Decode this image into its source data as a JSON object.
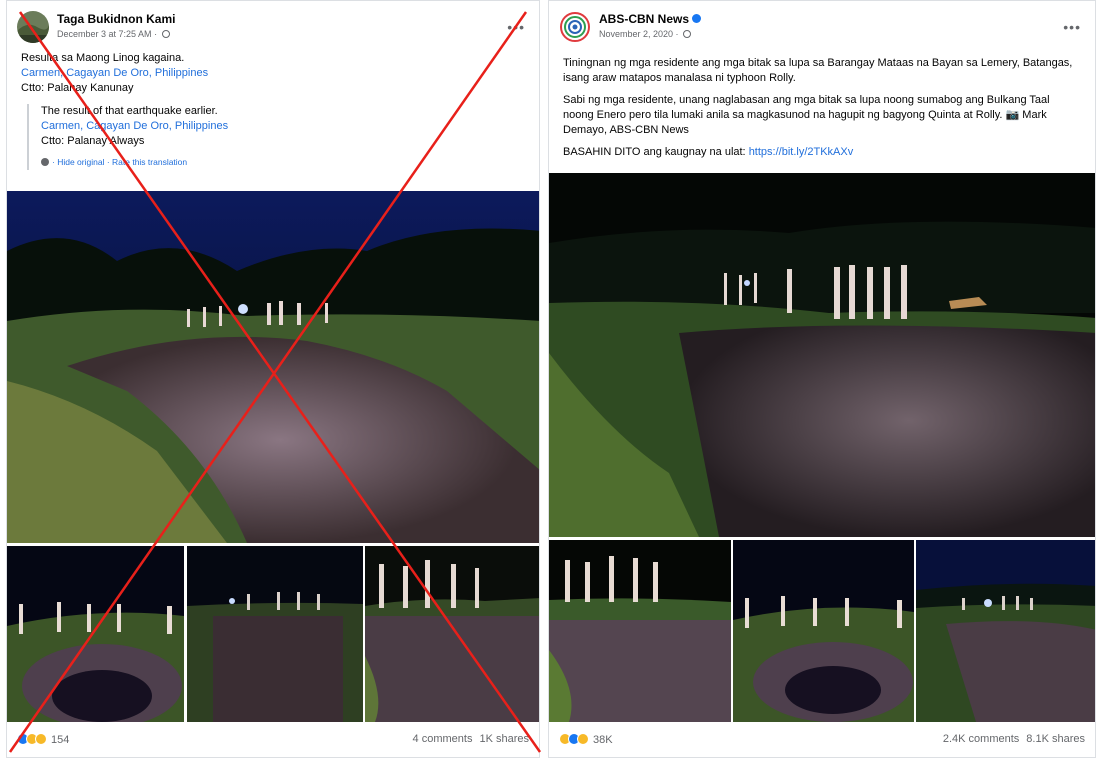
{
  "left_post": {
    "page_name": "Taga Bukidnon Kami",
    "date": "December 3 at 7:25 AM",
    "original_text": "Resulta sa Maong Linog kagaina.",
    "location": "Carmen, Cagayan De Oro, Philippines",
    "credit": "Ctto: Palanay Kanunay",
    "translation": {
      "text": "The result of that earthquake earlier.",
      "location": "Carmen, Cagayan De Oro, Philippines",
      "credit": "Ctto: Palanay Always",
      "hide_original": "Hide original",
      "rate": "Rate this translation"
    },
    "reaction_count": "154",
    "comments": "4 comments",
    "shares": "1K shares"
  },
  "right_post": {
    "page_name": "ABS-CBN News",
    "date": "November 2, 2020",
    "paragraph1": "Tiningnan ng mga residente ang mga bitak sa lupa sa Barangay Mataas na Bayan sa Lemery, Batangas, isang araw matapos manalasa ni typhoon Rolly.",
    "paragraph2": "Sabi ng mga residente, unang naglabasan ang mga bitak sa lupa noong sumabog ang Bulkang Taal noong Enero pero tila lumaki anila sa magkasunod na hagupit ng bagyong Quinta at Rolly. 📷 Mark Demayo, ABS-CBN News",
    "paragraph3_prefix": "BASAHIN DITO ang kaugnay na ulat: ",
    "link": "https://bit.ly/2TKkAXv",
    "reaction_count": "38K",
    "comments": "2.4K comments",
    "shares": "8.1K shares"
  },
  "colors": {
    "link": "#216fdb",
    "cross": "#e8201a",
    "like": "#1877f2",
    "haha": "#f7b928"
  }
}
